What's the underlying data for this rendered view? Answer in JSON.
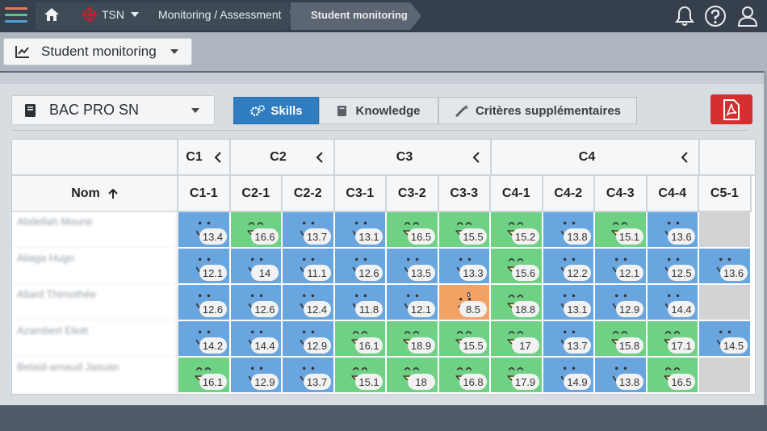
{
  "topbar": {
    "crumbs": [
      "TSN",
      "Monitoring / Assessment",
      "Student monitoring"
    ]
  },
  "view_select": {
    "label": "Student monitoring"
  },
  "diploma_select": {
    "label": "BAC PRO SN"
  },
  "tabs": [
    {
      "label": "Skills",
      "active": true
    },
    {
      "label": "Knowledge",
      "active": false
    },
    {
      "label": "Critères supplémentaires",
      "active": false
    }
  ],
  "grid": {
    "name_header": "Nom",
    "groups": [
      "C1",
      "C2",
      "C3",
      "C4"
    ],
    "columns": [
      "C1-1",
      "C2-1",
      "C2-2",
      "C3-1",
      "C3-2",
      "C3-3",
      "C4-1",
      "C4-2",
      "C4-3",
      "C4-4",
      "C5-1"
    ],
    "rows": [
      {
        "name": "Abdellah Mounir",
        "cells": [
          [
            "blue",
            "13.4"
          ],
          [
            "green",
            "16.6"
          ],
          [
            "blue",
            "13.7"
          ],
          [
            "blue",
            "13.1"
          ],
          [
            "green",
            "16.5"
          ],
          [
            "green",
            "15.5"
          ],
          [
            "green",
            "15.2"
          ],
          [
            "blue",
            "13.8"
          ],
          [
            "green",
            "15.1"
          ],
          [
            "blue",
            "13.6"
          ],
          [
            "grey",
            ""
          ]
        ]
      },
      {
        "name": "Aliaga Hugo",
        "cells": [
          [
            "blue",
            "12.1"
          ],
          [
            "blue",
            "14"
          ],
          [
            "blue",
            "11.1"
          ],
          [
            "blue",
            "12.6"
          ],
          [
            "blue",
            "13.5"
          ],
          [
            "blue",
            "13.3"
          ],
          [
            "green",
            "15.6"
          ],
          [
            "blue",
            "12.2"
          ],
          [
            "blue",
            "12.1"
          ],
          [
            "blue",
            "12.5"
          ],
          [
            "blue",
            "13.6"
          ]
        ]
      },
      {
        "name": "Allard Thimothée",
        "cells": [
          [
            "blue",
            "12.6"
          ],
          [
            "blue",
            "12.6"
          ],
          [
            "blue",
            "12.4"
          ],
          [
            "blue",
            "11.8"
          ],
          [
            "blue",
            "12.1"
          ],
          [
            "orange",
            "8.5"
          ],
          [
            "green",
            "18.8"
          ],
          [
            "blue",
            "13.1"
          ],
          [
            "blue",
            "12.9"
          ],
          [
            "blue",
            "14.4"
          ],
          [
            "grey",
            ""
          ]
        ]
      },
      {
        "name": "Azambert Eliott",
        "cells": [
          [
            "blue",
            "14.2"
          ],
          [
            "blue",
            "14.4"
          ],
          [
            "blue",
            "12.9"
          ],
          [
            "green",
            "16.1"
          ],
          [
            "green",
            "18.9"
          ],
          [
            "green",
            "15.5"
          ],
          [
            "green",
            "17"
          ],
          [
            "blue",
            "13.7"
          ],
          [
            "green",
            "15.8"
          ],
          [
            "green",
            "17.1"
          ],
          [
            "blue",
            "14.5"
          ]
        ]
      },
      {
        "name": "Belaid-arnaud Jasuan",
        "cells": [
          [
            "green",
            "16.1"
          ],
          [
            "blue",
            "12.9"
          ],
          [
            "blue",
            "13.7"
          ],
          [
            "green",
            "15.1"
          ],
          [
            "green",
            "18"
          ],
          [
            "green",
            "16.8"
          ],
          [
            "green",
            "17.9"
          ],
          [
            "blue",
            "14.9"
          ],
          [
            "blue",
            "13.8"
          ],
          [
            "green",
            "16.5"
          ],
          [
            "grey",
            ""
          ]
        ]
      }
    ]
  },
  "colors": {
    "accent": "#2f7cc0",
    "good": "#6fd184",
    "ok": "#69a5df",
    "low": "#f3a266",
    "pdf": "#d62f2f"
  },
  "icons": [
    "menu-icon",
    "home-icon",
    "tsn-logo-icon",
    "bell-icon",
    "help-icon",
    "user-icon",
    "chart-icon",
    "book-icon",
    "gears-icon",
    "wand-icon",
    "pdf-icon",
    "arrow-up-icon",
    "chevron-left-icon"
  ]
}
